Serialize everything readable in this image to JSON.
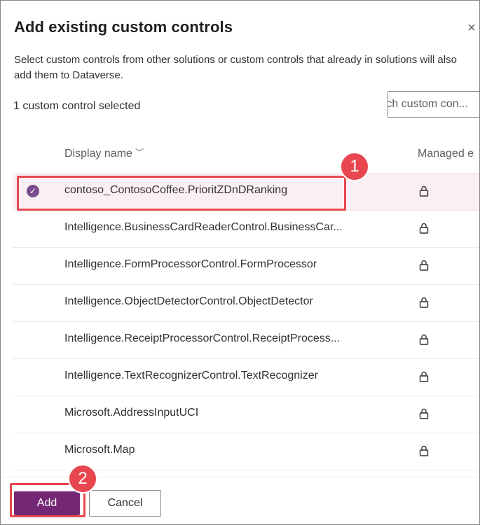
{
  "dialog": {
    "title": "Add existing custom controls",
    "close_icon": "×",
    "description": "Select custom controls from other solutions or custom controls that already in solutions will also add them to Dataverse.",
    "selected_count": "1 custom control selected",
    "search": {
      "placeholder": "rch custom con..."
    }
  },
  "list": {
    "columns": {
      "display_name": "Display name",
      "managed": "Managed e"
    },
    "rows": [
      {
        "name": "contoso_ContosoCoffee.PrioritZDnDRanking",
        "selected": true
      },
      {
        "name": "Intelligence.BusinessCardReaderControl.BusinessCar...",
        "selected": false
      },
      {
        "name": "Intelligence.FormProcessorControl.FormProcessor",
        "selected": false
      },
      {
        "name": "Intelligence.ObjectDetectorControl.ObjectDetector",
        "selected": false
      },
      {
        "name": "Intelligence.ReceiptProcessorControl.ReceiptProcess...",
        "selected": false
      },
      {
        "name": "Intelligence.TextRecognizerControl.TextRecognizer",
        "selected": false
      },
      {
        "name": "Microsoft.AddressInputUCI",
        "selected": false
      },
      {
        "name": "Microsoft.Map",
        "selected": false
      }
    ]
  },
  "footer": {
    "add_label": "Add",
    "cancel_label": "Cancel"
  },
  "annotations": {
    "badge1": "1",
    "badge2": "2"
  },
  "colors": {
    "accent": "#742774",
    "highlight": "#e8474f",
    "check": "#7b4d8f"
  }
}
